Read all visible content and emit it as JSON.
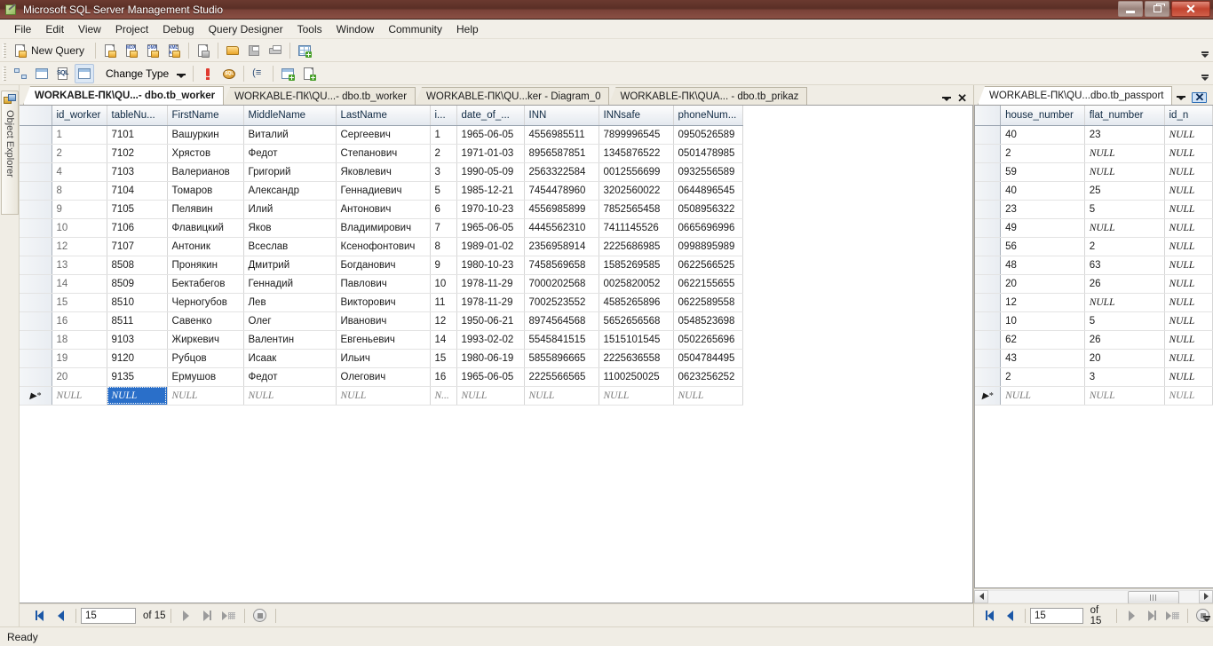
{
  "window": {
    "title": "Microsoft SQL Server Management Studio",
    "app_icon": "ssms-icon",
    "minimize_label": "Minimize",
    "maximize_label": "Restore",
    "close_label": "Close"
  },
  "menubar": {
    "items": [
      {
        "label": "File",
        "accel": "F"
      },
      {
        "label": "Edit",
        "accel": "E"
      },
      {
        "label": "View",
        "accel": "V"
      },
      {
        "label": "Project",
        "accel": "P"
      },
      {
        "label": "Debug",
        "accel": "D"
      },
      {
        "label": "Query Designer",
        "accel": "Q"
      },
      {
        "label": "Tools",
        "accel": "T"
      },
      {
        "label": "Window",
        "accel": "W"
      },
      {
        "label": "Community",
        "accel": "C"
      },
      {
        "label": "Help",
        "accel": "H"
      }
    ]
  },
  "toolbar_standard": {
    "new_query_label": "New Query",
    "buttons": [
      {
        "name": "new-query-button",
        "label": "New Query",
        "icon": "new-query-icon"
      },
      {
        "name": "new-database-query-button",
        "label": "",
        "icon": "db-engine-query-icon"
      },
      {
        "name": "new-analysis-mdx-query-button",
        "label": "",
        "icon": "mdx-query-icon"
      },
      {
        "name": "new-analysis-dmx-query-button",
        "label": "",
        "icon": "dmx-query-icon"
      },
      {
        "name": "new-analysis-xmla-query-button",
        "label": "",
        "icon": "xmla-query-icon"
      },
      {
        "name": "new-sql-compact-query-button",
        "label": "",
        "icon": "compact-query-icon"
      },
      {
        "name": "open-file-button",
        "label": "",
        "icon": "open-folder-icon"
      },
      {
        "name": "save-button",
        "label": "",
        "icon": "save-disk-icon"
      },
      {
        "name": "print-button",
        "label": "",
        "icon": "printer-icon"
      },
      {
        "name": "activity-monitor-button",
        "label": "",
        "icon": "activity-monitor-icon"
      }
    ]
  },
  "toolbar_designer": {
    "change_type_label": "Change Type",
    "buttons": [
      {
        "name": "show-diagram-pane-button",
        "icon": "diagram-pane-icon"
      },
      {
        "name": "show-criteria-pane-button",
        "icon": "criteria-pane-icon"
      },
      {
        "name": "show-sql-pane-button",
        "icon": "sql-pane-icon"
      },
      {
        "name": "show-results-pane-button",
        "icon": "results-pane-icon",
        "pressed": true
      },
      {
        "name": "verify-sql-button",
        "icon": "exclamation-icon"
      },
      {
        "name": "execute-sql-button",
        "icon": "execute-sql-icon"
      },
      {
        "name": "group-by-button",
        "icon": "group-by-icon"
      },
      {
        "name": "add-table-button",
        "icon": "add-table-icon"
      },
      {
        "name": "add-new-derived-table-button",
        "icon": "add-derived-table-icon"
      }
    ]
  },
  "object_explorer": {
    "label": "Object Explorer",
    "icon": "object-explorer-icon"
  },
  "left_pane": {
    "tabs": [
      {
        "label": "WORKABLE-ПК\\QU...- dbo.tb_worker",
        "active": true
      },
      {
        "label": "WORKABLE-ПК\\QU...- dbo.tb_worker",
        "active": false
      },
      {
        "label": "WORKABLE-ПК\\QU...ker - Diagram_0",
        "active": false
      },
      {
        "label": "WORKABLE-ПК\\QUA... - dbo.tb_prikaz",
        "active": false
      }
    ],
    "tab_menu_icon": "tab-list-dropdown-icon",
    "tab_close_icon": "close-icon",
    "grid": {
      "columns": [
        "id_worker",
        "tableNu...",
        "FirstName",
        "MiddleName",
        "LastName",
        "i...",
        "date_of_...",
        "INN",
        "INNsafe",
        "phoneNum..."
      ],
      "rows": [
        [
          "1",
          "7101",
          "Вашуркин",
          "Виталий",
          "Сергеевич",
          "1",
          "1965-06-05",
          "4556985511",
          "7899996545",
          "0950526589"
        ],
        [
          "2",
          "7102",
          "Хрястов",
          "Федот",
          "Степанович",
          "2",
          "1971-01-03",
          "8956587851",
          "1345876522",
          "0501478985"
        ],
        [
          "4",
          "7103",
          "Валерианов",
          "Григорий",
          "Яковлевич",
          "3",
          "1990-05-09",
          "2563322584",
          "0012556699",
          "0932556589"
        ],
        [
          "8",
          "7104",
          "Томаров",
          "Александр",
          "Геннадиевич",
          "5",
          "1985-12-21",
          "7454478960",
          "3202560022",
          "0644896545"
        ],
        [
          "9",
          "7105",
          "Пелявин",
          "Илий",
          "Антонович",
          "6",
          "1970-10-23",
          "4556985899",
          "7852565458",
          "0508956322"
        ],
        [
          "10",
          "7106",
          "Флавицкий",
          "Яков",
          "Владимирович",
          "7",
          "1965-06-05",
          "4445562310",
          "7411145526",
          "0665696996"
        ],
        [
          "12",
          "7107",
          "Антоник",
          "Всеслав",
          "Ксенофонтович",
          "8",
          "1989-01-02",
          "2356958914",
          "2225686985",
          "0998895989"
        ],
        [
          "13",
          "8508",
          "Пронякин",
          "Дмитрий",
          "Богданович",
          "9",
          "1980-10-23",
          "7458569658",
          "1585269585",
          "0622566525"
        ],
        [
          "14",
          "8509",
          "Бектабегов",
          "Геннадий",
          "Павлович",
          "10",
          "1978-11-29",
          "7000202568",
          "0025820052",
          "0622155655"
        ],
        [
          "15",
          "8510",
          "Черногубов",
          "Лев",
          "Викторович",
          "11",
          "1978-11-29",
          "7002523552",
          "4585265896",
          "0622589558"
        ],
        [
          "16",
          "8511",
          "Савенко",
          "Олег",
          "Иванович",
          "12",
          "1950-06-21",
          "8974564568",
          "5652656568",
          "0548523698"
        ],
        [
          "18",
          "9103",
          "Жиркевич",
          "Валентин",
          "Евгеньевич",
          "14",
          "1993-02-02",
          "5545841515",
          "1515101545",
          "0502265696"
        ],
        [
          "19",
          "9120",
          "Рубцов",
          "Исаак",
          "Ильич",
          "15",
          "1980-06-19",
          "5855896665",
          "2225636558",
          "0504784495"
        ],
        [
          "20",
          "9135",
          "Ермушов",
          "Федот",
          "Олегович",
          "16",
          "1965-06-05",
          "2225566565",
          "1100250025",
          "0623256252"
        ]
      ],
      "new_row": [
        "NULL",
        "NULL",
        "NULL",
        "NULL",
        "NULL",
        "N...",
        "NULL",
        "NULL",
        "NULL",
        "NULL"
      ],
      "new_row_marker": "▶*",
      "selected_cell": {
        "row": "new_row",
        "column_index": 1,
        "value": "NULL"
      }
    },
    "navigator": {
      "position": "15",
      "of_label": "of 15",
      "first_label": "Move first",
      "prev_label": "Move previous",
      "next_label": "Move next",
      "last_label": "Move last",
      "new_label": "Add new row",
      "stop_label": "Stop"
    }
  },
  "right_pane": {
    "tabs": [
      {
        "label": "WORKABLE-ПК\\QU...dbo.tb_passport",
        "active": true
      }
    ],
    "tab_menu_icon": "tab-list-dropdown-icon",
    "tab_close_icon": "close-icon",
    "grid": {
      "columns": [
        "house_number",
        "flat_number",
        "id_n"
      ],
      "rows": [
        [
          "40",
          "23",
          "NULL"
        ],
        [
          "2",
          "NULL",
          "NULL"
        ],
        [
          "59",
          "NULL",
          "NULL"
        ],
        [
          "40",
          "25",
          "NULL"
        ],
        [
          "23",
          "5",
          "NULL"
        ],
        [
          "49",
          "NULL",
          "NULL"
        ],
        [
          "56",
          "2",
          "NULL"
        ],
        [
          "48",
          "63",
          "NULL"
        ],
        [
          "20",
          "26",
          "NULL"
        ],
        [
          "12",
          "NULL",
          "NULL"
        ],
        [
          "10",
          "5",
          "NULL"
        ],
        [
          "62",
          "26",
          "NULL"
        ],
        [
          "43",
          "20",
          "NULL"
        ],
        [
          "2",
          "3",
          "NULL"
        ]
      ],
      "new_row": [
        "NULL",
        "NULL",
        "NULL"
      ],
      "new_row_marker": "▶*"
    },
    "scrollbar": {
      "left_arrow": "◀",
      "right_arrow": "▶"
    },
    "navigator": {
      "position": "15",
      "of_label": "of 15"
    }
  },
  "statusbar": {
    "message": "Ready"
  },
  "colors": {
    "titlebar_dark": "#5a2f26",
    "close_button": "#c2442f",
    "selection_blue": "#2a6fc9",
    "chrome_bg": "#f0ede5",
    "grid_bg": "#ffffff"
  }
}
